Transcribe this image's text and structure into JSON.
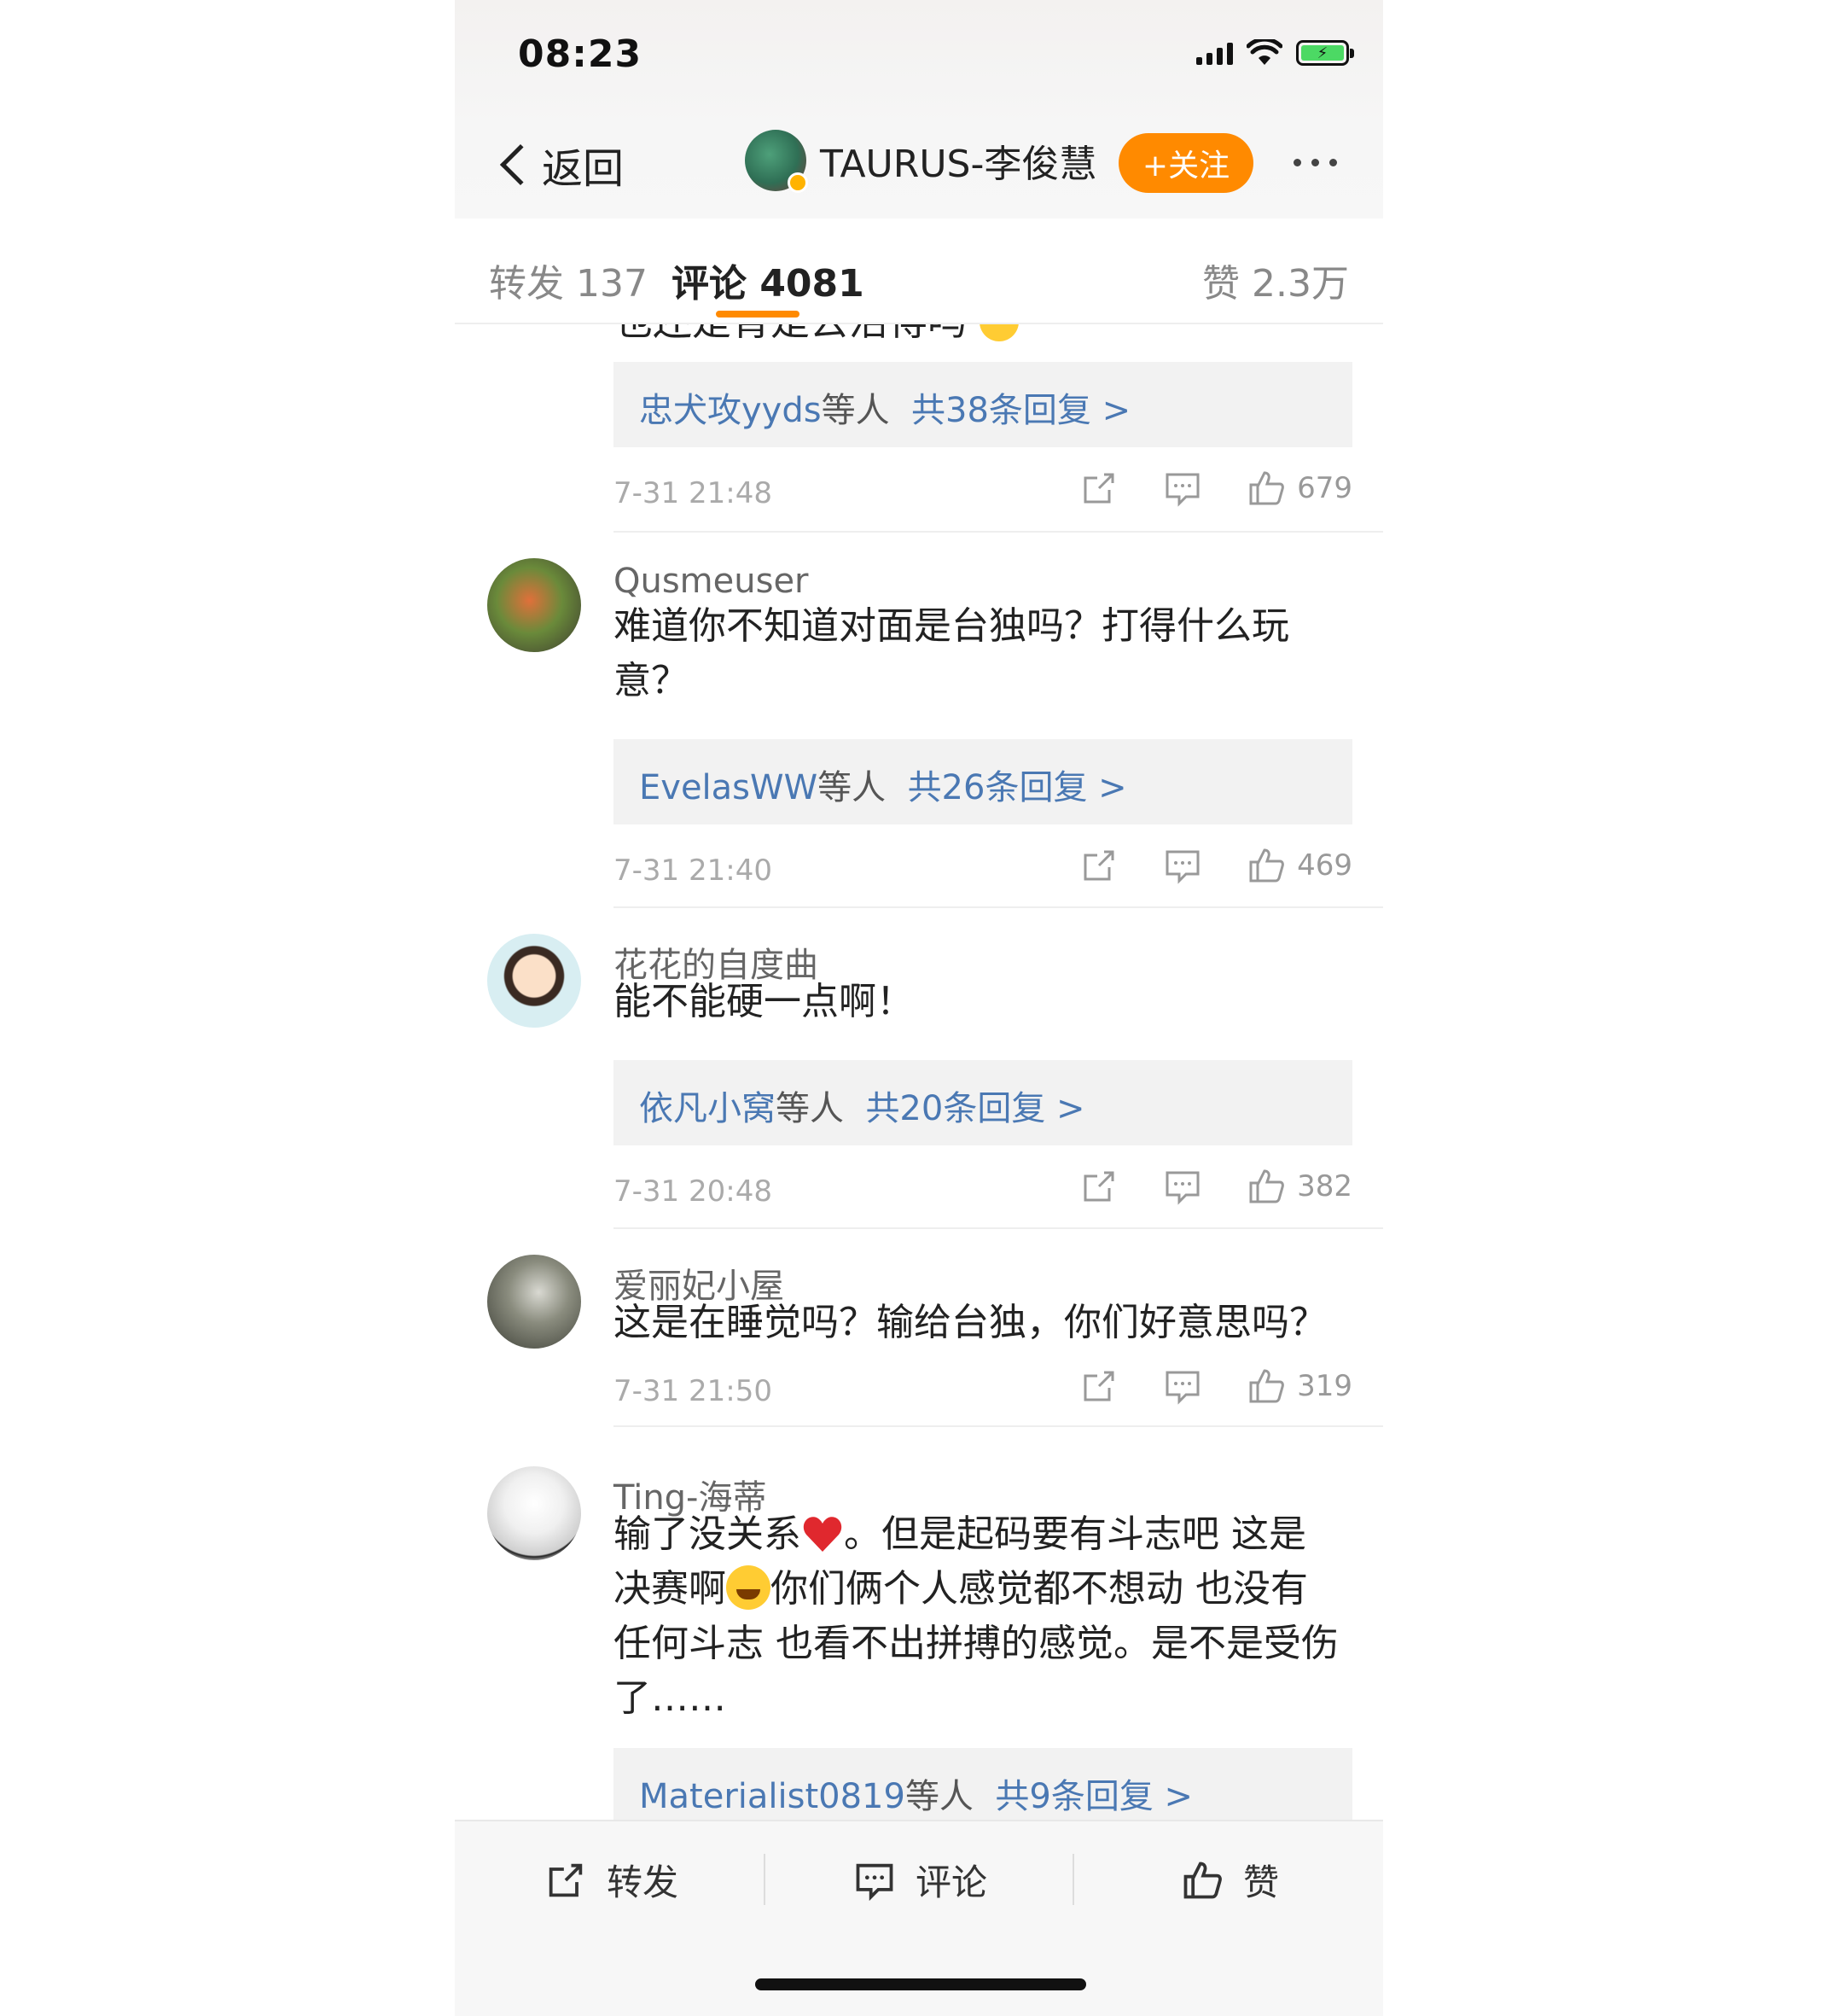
{
  "status": {
    "time": "08:23"
  },
  "nav": {
    "back_label": "返回",
    "account_name": "TAURUS-李俊慧",
    "follow_label": "+关注"
  },
  "tabs": {
    "repost": "转发 137",
    "comments": "评论 4081",
    "likes": "赞 2.3万"
  },
  "partial_comment_text": "也还是背是去活得吗",
  "comments": [
    {
      "reply": {
        "who": "忠犬攻yyds",
        "suffix": "等人",
        "count": "共38条回复 >"
      },
      "time": "7-31 21:48",
      "likes": "679"
    },
    {
      "user": "Qusmeuser",
      "text_line1": "难道你不知道对面是台独吗？打得什么玩",
      "text_line2": "意？",
      "reply": {
        "who": "EvelasWW",
        "suffix": "等人",
        "count": "共26条回复 >"
      },
      "time": "7-31 21:40",
      "likes": "469"
    },
    {
      "user": "花花的自度曲",
      "text_line1": "能不能硬一点啊！",
      "reply": {
        "who": "依凡小窝",
        "suffix": "等人",
        "count": "共20条回复 >"
      },
      "time": "7-31 20:48",
      "likes": "382"
    },
    {
      "user": "爱丽妃小屋",
      "text_line1": "这是在睡觉吗？输给台独，你们好意思吗？",
      "time": "7-31 21:50",
      "likes": "319"
    },
    {
      "user": "Ting-海蒂",
      "text_line1a": "输了没关系",
      "text_line1b": "。但是起码要有斗志吧 这是",
      "text_line2a": "决赛啊",
      "text_line2b": "你们俩个人感觉都不想动 也没有",
      "text_line3": "任何斗志 也看不出拼搏的感觉。是不是受伤",
      "text_line4": "了……",
      "reply": {
        "who": "Materialist0819",
        "suffix": "等人",
        "count": "共9条回复 >"
      }
    }
  ],
  "bottom": {
    "repost": "转发",
    "comment": "评论",
    "like": "赞"
  },
  "colors": {
    "accent": "#ff8a00",
    "link": "#4a78b3"
  }
}
